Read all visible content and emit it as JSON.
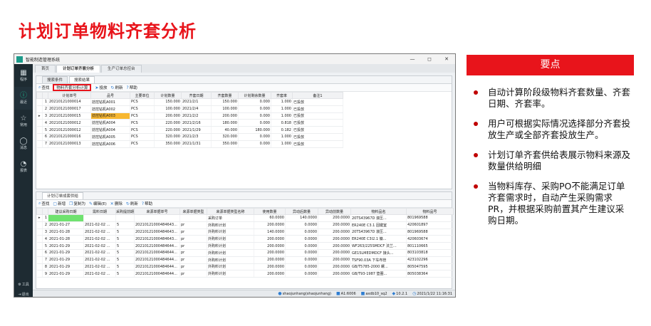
{
  "slide": {
    "title": "计划订单物料齐套分析",
    "key_header": "要点",
    "points": [
      "自动计算阶段级物料齐套数量、齐套日期、齐套率。",
      "用户可根据实际情况选择部分齐套投放生产或全部齐套投放生产。",
      "计划订单齐套供给表展示物料来源及数量供给明细",
      "当物料库存、采购PO不能满足订单齐套需求时，自动产生采购需求PR，并根据采购前置其产生建议采购日期。"
    ],
    "colors": {
      "accent": "#e8141b",
      "sidebar": "#1e2b32",
      "active_icon": "#1db68f"
    }
  },
  "window": {
    "title": "智能制造管理系统",
    "controls": [
      "—",
      "◻",
      "✕"
    ],
    "sidebar": [
      {
        "icon": "grid-icon",
        "glyph": "▦",
        "label": "程序"
      },
      {
        "icon": "info-icon",
        "glyph": "ⓘ",
        "label": "最近",
        "active": true
      },
      {
        "icon": "star-icon",
        "glyph": "☆",
        "label": "常用"
      },
      {
        "icon": "message-icon",
        "glyph": "◯",
        "label": "消息"
      },
      {
        "icon": "report-icon",
        "glyph": "◔",
        "label": "报表"
      }
    ],
    "sidebar_bottom": [
      {
        "icon": "settings-icon",
        "glyph": "⚙",
        "label": "工具"
      },
      {
        "icon": "exit-icon",
        "glyph": "⇥",
        "label": "退出"
      }
    ],
    "top_tabs": [
      "首页",
      "计划订单齐套分析",
      "生产订单总控台"
    ],
    "upper_tabs": [
      "搜索条件",
      "搜索结果"
    ],
    "upper_toolbar": [
      {
        "icon": "search-icon",
        "glyph": "⌕",
        "label": "查找"
      },
      {
        "icon": "calc-icon",
        "glyph": "",
        "label": "物料齐套分析计算",
        "highlight": true
      },
      {
        "icon": "release-icon",
        "glyph": "➤",
        "label": "投放"
      },
      {
        "icon": "refresh-icon",
        "glyph": "↻",
        "label": "刷新"
      },
      {
        "icon": "help-icon",
        "glyph": "?",
        "label": "帮助"
      }
    ],
    "upper_table": {
      "columns": [
        "",
        "",
        "计划单号",
        "品号",
        "主要单位",
        "计划数量",
        "齐套日期",
        "齐套数量",
        "计划剩余数量",
        "齐套率",
        "备注1"
      ],
      "rows": [
        [
          "",
          "1",
          "20210121000014",
          "捻控钻机A001",
          "PCS",
          "150.000",
          "2021/2/1",
          "150.000",
          "0.000",
          "1.000",
          "已投放"
        ],
        [
          "",
          "2",
          "20210121000017",
          "捻控钻机A002",
          "PCS",
          "100.000",
          "2021/2/4",
          "100.000",
          "0.000",
          "1.000",
          "已投放"
        ],
        [
          "▸",
          "3",
          "20210121000015",
          "捻控钻机A003",
          "PCS",
          "200.000",
          "2021/2/2",
          "200.000",
          "0.000",
          "1.000",
          "已投放"
        ],
        [
          "",
          "4",
          "20210121000012",
          "捻控钻机A004",
          "PCS",
          "220.000",
          "2021/2/16",
          "180.000",
          "0.000",
          "0.818",
          "已投放"
        ],
        [
          "",
          "5",
          "20210121000012",
          "捻控钻机A004",
          "PCS",
          "220.000",
          "2021/1/29",
          "40.000",
          "180.000",
          "0.182",
          "已投放"
        ],
        [
          "",
          "6",
          "20210121000016",
          "捻控钻机A005",
          "PCS",
          "320.000",
          "2021/2/3",
          "320.000",
          "0.000",
          "1.000",
          "已投放"
        ],
        [
          "",
          "7",
          "20210121000013",
          "捻控钻机A006",
          "PCS",
          "350.000",
          "2021/1/31",
          "350.000",
          "0.000",
          "1.000",
          "已投放"
        ]
      ]
    },
    "lower_tabs": [
      "计划订单成套供给"
    ],
    "lower_toolbar": [
      {
        "icon": "search-icon",
        "glyph": "⌕",
        "label": "查找"
      },
      {
        "icon": "new-icon",
        "glyph": "▢",
        "label": "新增"
      },
      {
        "icon": "copy-icon",
        "glyph": "❐",
        "label": "复制为"
      },
      {
        "icon": "edit-icon",
        "glyph": "✎",
        "label": "编辑(E)"
      },
      {
        "icon": "delete-icon",
        "glyph": "✕",
        "label": "删除"
      },
      {
        "icon": "refresh-icon",
        "glyph": "↻",
        "label": "刷新"
      },
      {
        "icon": "help-icon",
        "glyph": "?",
        "label": "帮助"
      }
    ],
    "lower_table": {
      "columns": [
        "",
        "",
        "建议采购日期",
        "需料日期",
        "采购提前期",
        "来源单据单号",
        "来源单据类型",
        "来源单据类型名称",
        "使用数量",
        "异动后数量",
        "异动前数量",
        "物料品名",
        "物料品号"
      ],
      "rows": [
        [
          "▸",
          "1",
          "",
          "",
          "",
          "",
          "",
          "采购订单",
          "60.0000",
          "140.0000",
          "200.0000",
          "20TS43967D 滚压...",
          "801969588"
        ],
        [
          "",
          "2",
          "2021-01-27",
          "2021-02-02 ...",
          "5",
          "20210121000484643...",
          "pr",
          "外购料计划",
          "200.0000",
          "0.0000",
          "200.0000",
          "ER240E C3.1 固键室",
          "420601897"
        ],
        [
          "",
          "3",
          "2021-01-28",
          "2021-02-02 ...",
          "5",
          "20210121000484643...",
          "pr",
          "外购料计划",
          "140.0000",
          "0.0000",
          "200.0000",
          "20TS43967D 滚压...",
          "801969588"
        ],
        [
          "",
          "4",
          "2021-01-28",
          "2021-02-02 ...",
          "5",
          "20210121000484643...",
          "pr",
          "外购料计划",
          "200.0000",
          "0.0000",
          "200.0000",
          "ER240E C3I2.1 镰...",
          "420603674"
        ],
        [
          "",
          "5",
          "2021-01-29",
          "2021-02-02 ...",
          "5",
          "20210121000484644...",
          "pr",
          "外购料计划",
          "200.0000",
          "0.0000",
          "200.0000",
          "WF263/225SMDCF 法兰...",
          "801110665"
        ],
        [
          "",
          "6",
          "2021-01-29",
          "2021-02-02 ...",
          "5",
          "20210121000484644...",
          "pr",
          "外购料计划",
          "200.0000",
          "0.0000",
          "200.0000",
          "GE15LMEDMDCF 接头...",
          "803103818"
        ],
        [
          "",
          "7",
          "2021-01-29",
          "2021-02-02 ...",
          "5",
          "20210121000484644...",
          "pr",
          "外购料计划",
          "200.0000",
          "0.0000",
          "200.0000",
          "TSF90.03A 下车布管",
          "423102296"
        ],
        [
          "",
          "8",
          "2021-01-29",
          "2021-02-02 ...",
          "5",
          "20210121000484644...",
          "pr",
          "外购料计划",
          "200.0000",
          "0.0000",
          "200.0000",
          "GB/T5785-2000 螺...",
          "805047595"
        ],
        [
          "",
          "9",
          "2021-01-29",
          "2021-02-02 ...",
          "5",
          "20210121000484644...",
          "pr",
          "外购料计划",
          "200.0000",
          "0.0000",
          "200.0000",
          "GB/T93-1987 垫圈...",
          "805038364"
        ]
      ]
    },
    "status": [
      {
        "icon": "user-icon",
        "glyph": "●",
        "label": "shaojunhang(shaojunhang)"
      },
      {
        "icon": "host-icon",
        "glyph": "■",
        "label": "A1:6006"
      },
      {
        "icon": "db-icon",
        "glyph": "■",
        "label": "axdb10_sq2"
      },
      {
        "icon": "version-icon",
        "glyph": "◆",
        "label": "10.2.1"
      },
      {
        "icon": "clock-icon",
        "glyph": "◷",
        "label": "2021/1/22 11:16:31"
      }
    ]
  }
}
